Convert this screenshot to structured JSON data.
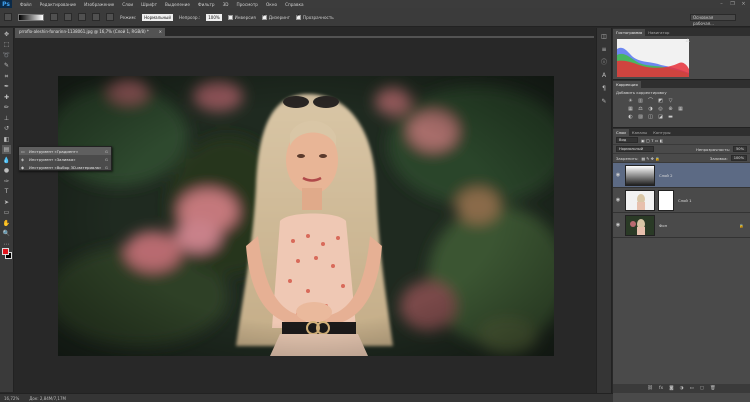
{
  "app": {
    "logo": "Ps"
  },
  "menu": [
    "Файл",
    "Редактирование",
    "Изображение",
    "Слои",
    "Шрифт",
    "Выделение",
    "Фильтр",
    "3D",
    "Просмотр",
    "Окно",
    "Справка"
  ],
  "options": {
    "mode_label": "Режим:",
    "mode_value": "Нормальный",
    "opacity_label": "Непрозр.:",
    "opacity_value": "100%",
    "inverse_label": "Инверсия",
    "dither_label": "Дизеринг",
    "transparency_label": "Прозрачность",
    "workspace": "Основная рабочая..."
  },
  "document": {
    "tab_title": "prroflo-aleshin-fonarinn-1138061.jpg @ 16,7% (Слой 1, RGB/8) *",
    "close": "×"
  },
  "flyout": {
    "items": [
      {
        "icon": "gradient-icon",
        "glyph": "▭",
        "label": "Инструмент «Градиент»",
        "key": "G"
      },
      {
        "icon": "paint-bucket-icon",
        "glyph": "◈",
        "label": "Инструмент «Заливка»",
        "key": "G"
      },
      {
        "icon": "3d-material-drop-icon",
        "glyph": "◆",
        "label": "Инструмент «Выбор 3D-материала»",
        "key": "G"
      }
    ]
  },
  "status": {
    "zoom": "16,72%",
    "doc_size": "Док: 2,84M/7,17M"
  },
  "panels": {
    "histogram_tabs": [
      "Гистограмма",
      "Навигатор"
    ],
    "warning_glyph": "⚠",
    "adjustments_tab": "Коррекция",
    "adjustments_title": "Добавить корректировку",
    "layers_tabs": [
      "Слои",
      "Каналы",
      "Контуры"
    ],
    "kind_label": "Вид",
    "blend_mode": "Нормальный",
    "opacity_label": "Непрозрачность:",
    "opacity_value": "50%",
    "lock_label": "Закрепить:",
    "fill_label": "Заливка:",
    "fill_value": "100%",
    "layers": [
      {
        "name": "Слой 2",
        "selected": true,
        "type": "gradient"
      },
      {
        "name": "Слой 1",
        "selected": false,
        "type": "cutout"
      },
      {
        "name": "Фон",
        "selected": false,
        "type": "photo"
      }
    ]
  },
  "colors": {
    "foreground": "#e0131b",
    "background": "#000000",
    "selected_layer": "#5c6a84"
  }
}
